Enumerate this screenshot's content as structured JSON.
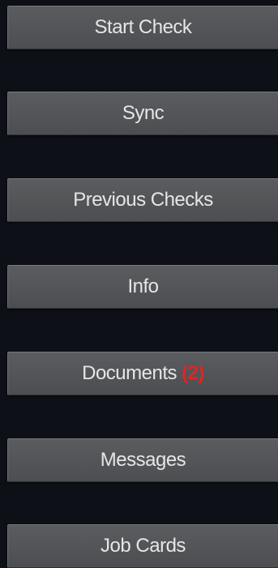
{
  "menu": {
    "start_check": "Start Check",
    "sync": "Sync",
    "previous_checks": "Previous Checks",
    "info": "Info",
    "documents": "Documents",
    "documents_badge": "(2)",
    "messages": "Messages",
    "job_cards": "Job Cards"
  },
  "colors": {
    "background": "#0d1017",
    "button": "#525457",
    "button_text": "#e6e6e6",
    "badge": "#e02424"
  }
}
